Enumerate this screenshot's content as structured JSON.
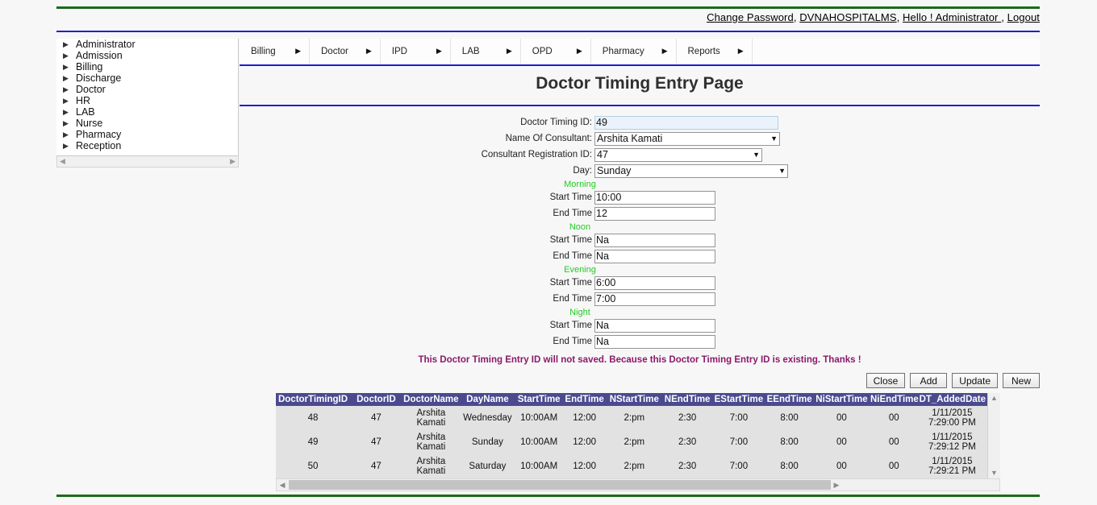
{
  "header": {
    "links": [
      {
        "label": "Change Password"
      },
      {
        "label": "DVNAHOSPITALMS"
      },
      {
        "label": "Hello ! Administrator "
      },
      {
        "label": "Logout"
      }
    ],
    "separator": ", "
  },
  "sidebar": {
    "items": [
      {
        "label": "Administrator"
      },
      {
        "label": "Admission"
      },
      {
        "label": "Billing"
      },
      {
        "label": "Discharge"
      },
      {
        "label": "Doctor"
      },
      {
        "label": "HR"
      },
      {
        "label": "LAB"
      },
      {
        "label": "Nurse"
      },
      {
        "label": "Pharmacy"
      },
      {
        "label": "Reception"
      }
    ],
    "scroll_left_icon": "◀",
    "scroll_right_icon": "▶"
  },
  "menubar": {
    "items": [
      {
        "label": "Billing"
      },
      {
        "label": "Doctor"
      },
      {
        "label": "IPD"
      },
      {
        "label": "LAB"
      },
      {
        "label": "OPD"
      },
      {
        "label": "Pharmacy"
      },
      {
        "label": "Reports"
      }
    ],
    "caret": "▶"
  },
  "main": {
    "title": "Doctor Timing Entry Page",
    "form": {
      "doctor_timing_id": {
        "label": "Doctor Timing ID:",
        "value": "49"
      },
      "consultant_name": {
        "label": "Name Of Consultant:",
        "value": "Arshita Kamati"
      },
      "consultant_reg_id": {
        "label": "Consultant Registration ID:",
        "value": "47"
      },
      "day": {
        "label": "Day:",
        "value": "Sunday"
      },
      "sections": [
        {
          "name": "Morning",
          "start": {
            "label": "Start Time",
            "value": "10:00"
          },
          "end": {
            "label": "End Time",
            "value": "12"
          }
        },
        {
          "name": "Noon",
          "start": {
            "label": "Start Time",
            "value": "Na"
          },
          "end": {
            "label": "End Time",
            "value": "Na"
          }
        },
        {
          "name": "Evening",
          "start": {
            "label": "Start Time",
            "value": "6:00"
          },
          "end": {
            "label": "End Time",
            "value": "7:00"
          }
        },
        {
          "name": "Night",
          "start": {
            "label": "Start Time",
            "value": "Na"
          },
          "end": {
            "label": "End Time",
            "value": "Na"
          }
        }
      ],
      "select_caret": "▼"
    },
    "message": "This Doctor Timing Entry ID will not saved. Because this Doctor Timing Entry ID is existing. Thanks !",
    "buttons": [
      {
        "label": "Close"
      },
      {
        "label": "Add"
      },
      {
        "label": "Update"
      },
      {
        "label": "New"
      }
    ],
    "grid": {
      "columns": [
        "DoctorTimingID",
        "DoctorID",
        "DoctorName",
        "DayName",
        "StartTime",
        "EndTime",
        "NStartTime",
        "NEndTime",
        "EStartTime",
        "EEndTime",
        "NiStartTime",
        "NiEndTime",
        "DT_AddedDate",
        ""
      ],
      "rows": [
        {
          "DoctorTimingID": "48",
          "DoctorID": "47",
          "DoctorName": "Arshita Kamati",
          "DayName": "Wednesday",
          "StartTime": "10:00AM",
          "EndTime": "12:00",
          "NStartTime": "2:pm",
          "NEndTime": "2:30",
          "EStartTime": "7:00",
          "EEndTime": "8:00",
          "NiStartTime": "00",
          "NiEndTime": "00",
          "DT_AddedDate": "1/11/2015 7:29:00 PM",
          "extra": "."
        },
        {
          "DoctorTimingID": "49",
          "DoctorID": "47",
          "DoctorName": "Arshita Kamati",
          "DayName": "Sunday",
          "StartTime": "10:00AM",
          "EndTime": "12:00",
          "NStartTime": "2:pm",
          "NEndTime": "2:30",
          "EStartTime": "7:00",
          "EEndTime": "8:00",
          "NiStartTime": "00",
          "NiEndTime": "00",
          "DT_AddedDate": "1/11/2015 7:29:12 PM",
          "extra": "."
        },
        {
          "DoctorTimingID": "50",
          "DoctorID": "47",
          "DoctorName": "Arshita Kamati",
          "DayName": "Saturday",
          "StartTime": "10:00AM",
          "EndTime": "12:00",
          "NStartTime": "2:pm",
          "NEndTime": "2:30",
          "EStartTime": "7:00",
          "EEndTime": "8:00",
          "NiStartTime": "00",
          "NiEndTime": "00",
          "DT_AddedDate": "1/11/2015 7:29:21 PM",
          "extra": "."
        }
      ],
      "scroll_up_icon": "▲",
      "scroll_down_icon": "▼",
      "scroll_left_icon": "◀",
      "scroll_right_icon": "▶"
    }
  },
  "colors": {
    "rule_green": "#1b6b1b",
    "rule_blue": "#1f1fcf",
    "grid_header": "#4a4a8f",
    "section_label": "#22cc22",
    "message": "#8b1a6b"
  }
}
